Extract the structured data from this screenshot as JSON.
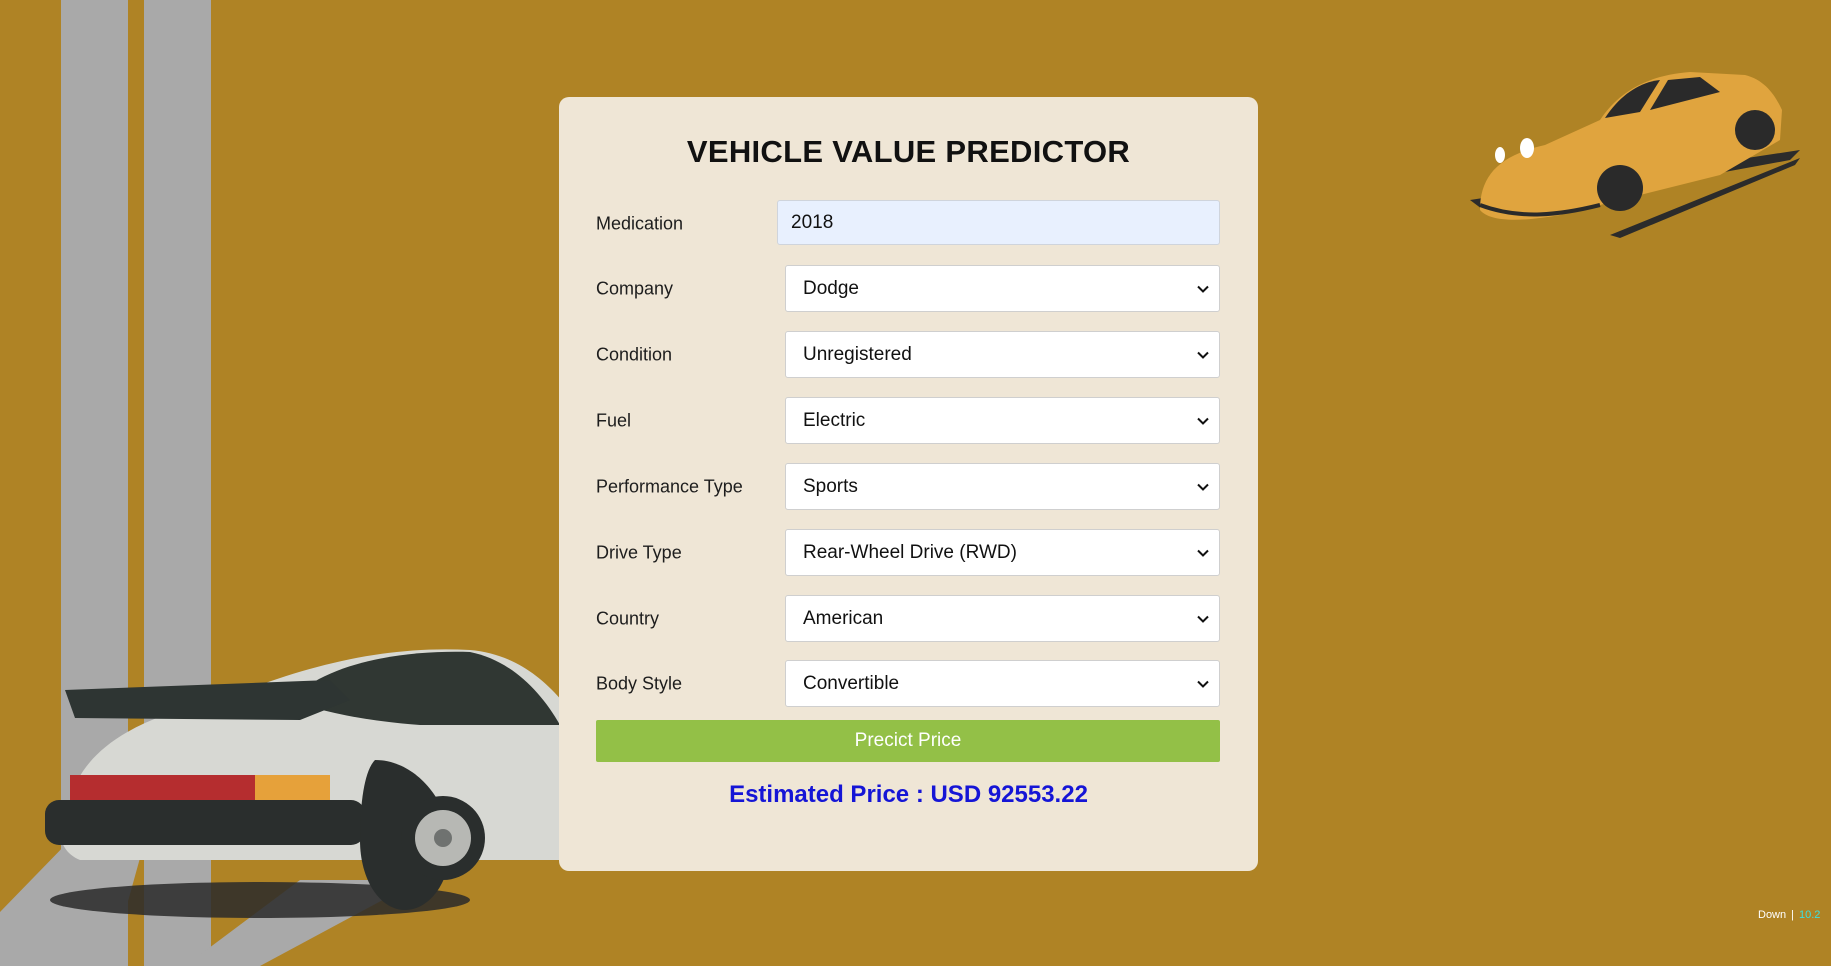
{
  "title": "VEHICLE VALUE PREDICTOR",
  "form": {
    "year": {
      "label": "Medication",
      "value": "2018"
    },
    "company": {
      "label": "Company",
      "value": "Dodge"
    },
    "condition": {
      "label": "Condition",
      "value": "Unregistered"
    },
    "fuel": {
      "label": "Fuel",
      "value": "Electric"
    },
    "performance": {
      "label": "Performance Type",
      "value": "Sports"
    },
    "drive": {
      "label": "Drive Type",
      "value": "Rear-Wheel Drive (RWD)"
    },
    "country": {
      "label": "Country",
      "value": "American"
    },
    "body": {
      "label": "Body Style",
      "value": "Convertible"
    }
  },
  "predict_button": "Precict Price",
  "result": "Estimated Price : USD 92553.22",
  "status": {
    "label": "Down",
    "separator": "|",
    "value": "10.2"
  },
  "colors": {
    "background": "#AF8325",
    "card": "#EFE6D6",
    "button": "#93C047",
    "result": "#1515D6",
    "stripes": "#A9A9A9",
    "car_body": "#D7D8D3",
    "car_yellow": "#E0A43E"
  },
  "icons": {
    "chevron": "chevron-down-icon"
  },
  "illustrations": {
    "left": "white-sports-car-rear-illustration",
    "right": "yellow-sports-car-illustration"
  }
}
